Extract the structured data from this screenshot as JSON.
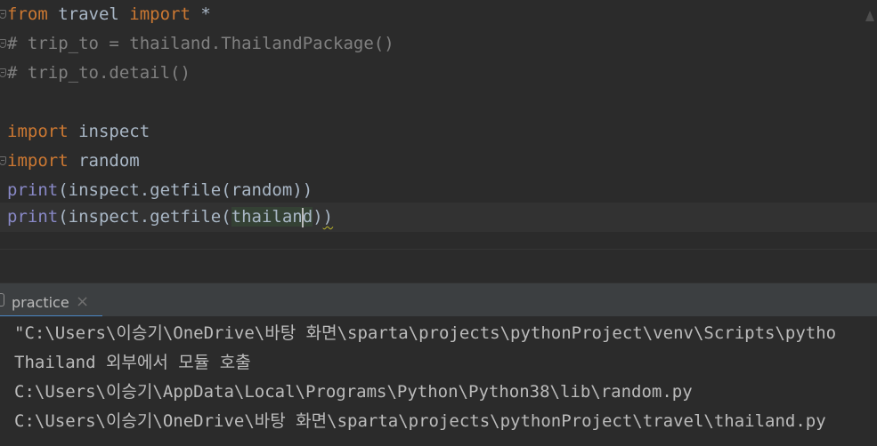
{
  "editor": {
    "lines": [
      {
        "keyword": "from",
        "module": " travel ",
        "keyword2": "import",
        "rest": " *"
      },
      {
        "comment": "# trip_to = thailand.ThailandPackage()"
      },
      {
        "comment": "# trip_to.detail()"
      },
      {
        "keyword": "import",
        "rest": " inspect"
      },
      {
        "keyword": "import",
        "rest": " random"
      },
      {
        "builtin": "print",
        "before": "(inspect.getfile(",
        "arg": "random",
        "after": "))"
      },
      {
        "builtin": "print",
        "before": "(inspect.getfile(",
        "arg_a": "thailan",
        "arg_b": "d",
        "after_a": ")",
        "after_b": ")"
      }
    ]
  },
  "run": {
    "tab_label": "practice",
    "close_glyph": "×"
  },
  "console": {
    "lines": [
      "\"C:\\Users\\이승기\\OneDrive\\바탕 화면\\sparta\\projects\\pythonProject\\venv\\Scripts\\pytho",
      "Thailand 외부에서 모듈 호출",
      "C:\\Users\\이승기\\AppData\\Local\\Programs\\Python\\Python38\\lib\\random.py",
      "C:\\Users\\이승기\\OneDrive\\바탕 화면\\sparta\\projects\\pythonProject\\travel\\thailand.py"
    ]
  },
  "colors": {
    "background": "#2b2b2b",
    "keyword": "#cc7832",
    "comment": "#808080",
    "builtin": "#8888c6",
    "text": "#a9b7c6",
    "tab_underline": "#4a88c7"
  }
}
